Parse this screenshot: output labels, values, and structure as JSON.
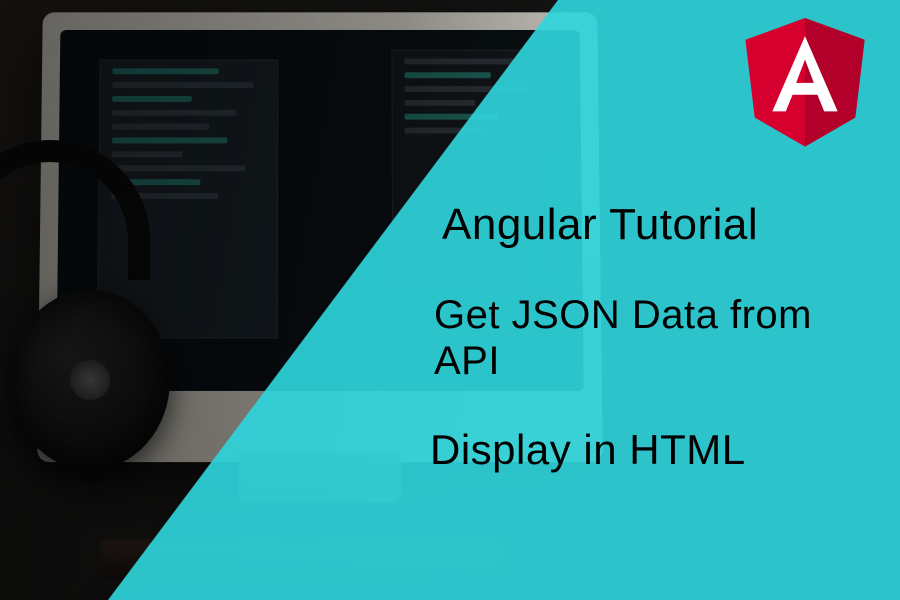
{
  "overlay": {
    "color": "#2FD4DA"
  },
  "logo": {
    "name": "angular-logo",
    "letter": "A",
    "shield_color": "#D6002F",
    "shield_dark": "#B3002A"
  },
  "text": {
    "title": "Angular Tutorial",
    "line2": "Get JSON Data from API",
    "line3": "Display in HTML"
  }
}
